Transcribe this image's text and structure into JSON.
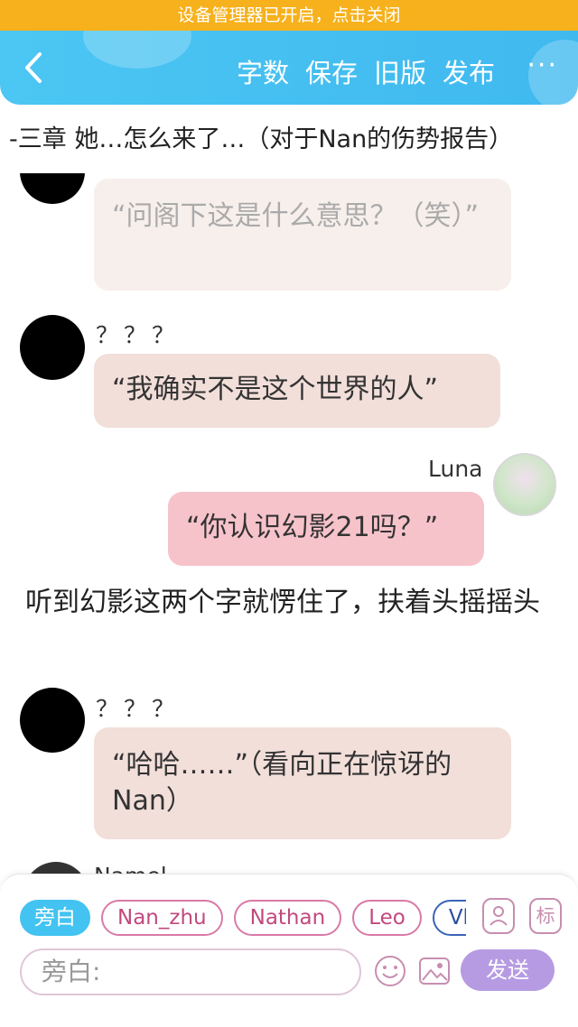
{
  "notice": "设备管理器已开启，点击关闭",
  "toolbar": {
    "word_count": "字数",
    "save": "保存",
    "old_version": "旧版",
    "publish": "发布",
    "more": "···"
  },
  "chapter_title": "-三章 她…怎么来了…（对于Nan的伤势报告）",
  "messages": [
    {
      "text": "“问阁下这是什么意思？（笑）”"
    },
    {
      "speaker": "？？？",
      "text": "“我确实不是这个世界的人”"
    },
    {
      "speaker": "Luna",
      "text": "“你认识幻影21吗？”"
    },
    {
      "narration": "听到幻影这两个字就愣住了，扶着头摇摇头"
    },
    {
      "speaker": "？？？",
      "text": "“哈哈……”（看向正在惊讶的Nan）"
    },
    {
      "speaker": "Namel"
    }
  ],
  "composer": {
    "chips": [
      "旁白",
      "Nan_zhu",
      "Nathan",
      "Leo",
      "Vla"
    ],
    "role_icon": "person-card-icon",
    "tag_label": "标",
    "placeholder": "旁白:",
    "send": "发送"
  },
  "colors": {
    "topbar": "#43c3f1",
    "notice": "#f6b11c",
    "bubble_other": "#f2dfda",
    "bubble_me": "#f7c3cb",
    "send": "#b69be3"
  }
}
